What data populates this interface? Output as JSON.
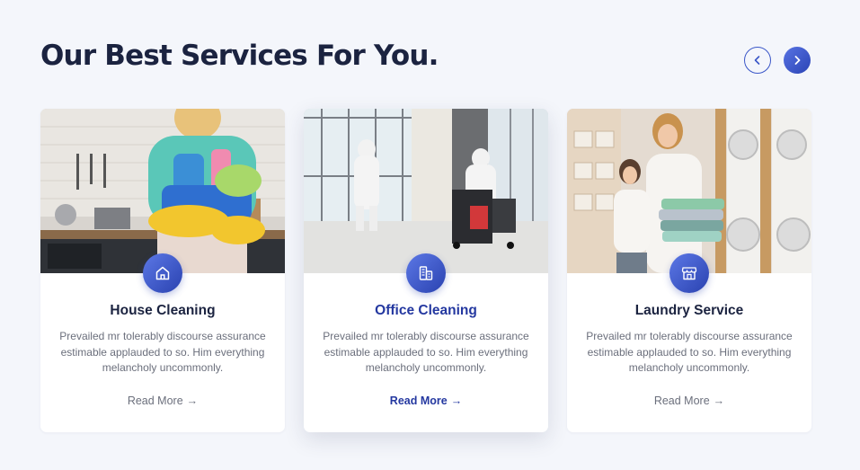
{
  "section": {
    "title": "Our Best Services For You."
  },
  "nav": {
    "prev_icon": "chevron-left-icon",
    "next_icon": "chevron-right-icon",
    "accent": "#2f4bbf"
  },
  "cards": [
    {
      "title": "House Cleaning",
      "description": "Prevailed mr tolerably discourse assurance estimable applauded to so. Him everything melancholy uncommonly.",
      "link": "Read More",
      "arrow": "→",
      "icon": "house-icon",
      "active": false
    },
    {
      "title": "Office Cleaning",
      "description": "Prevailed mr tolerably discourse assurance estimable applauded to so. Him everything melancholy uncommonly.",
      "link": "Read More",
      "arrow": "→",
      "icon": "office-building-icon",
      "active": true
    },
    {
      "title": "Laundry Service",
      "description": "Prevailed mr tolerably discourse assurance estimable applauded to so. Him everything melancholy uncommonly.",
      "link": "Read More",
      "arrow": "→",
      "icon": "laundry-store-icon",
      "active": false
    }
  ]
}
